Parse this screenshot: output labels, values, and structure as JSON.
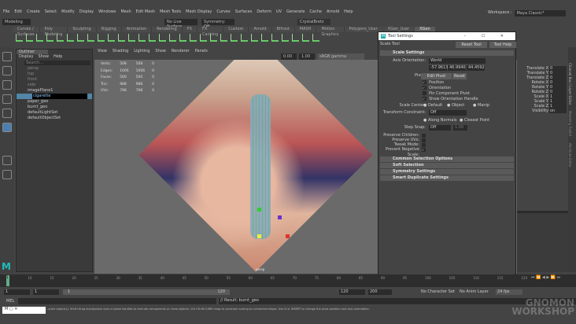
{
  "menu": [
    "File",
    "Edit",
    "Create",
    "Select",
    "Modify",
    "Display",
    "Windows",
    "Mesh",
    "Edit Mesh",
    "Mesh Tools",
    "Mesh Display",
    "Curves",
    "Surfaces",
    "Deform",
    "UV",
    "Generate",
    "Cache",
    "Arnold",
    "Help"
  ],
  "workspace": {
    "label": "Workspace :",
    "value": "Maya Classic*"
  },
  "status": {
    "mode": "Modeling",
    "live": "No Live Surface",
    "symmetry": "Symmetry: Off",
    "user": "CrystalBretz"
  },
  "shelf_tabs": [
    "Curves / Surfaces",
    "Poly Modeling",
    "Sculpting",
    "Rigging",
    "Animation",
    "Rendering",
    "FX",
    "FX Caching",
    "Custom",
    "Arnold",
    "Bifrost",
    "MASH",
    "Motion Graphics",
    "Polygons_User",
    "XGen_User",
    "XGen"
  ],
  "outliner": {
    "title": "Outliner",
    "menu": [
      "Display",
      "Show",
      "Help"
    ],
    "search": "Search...",
    "items": [
      "persp",
      "top",
      "front",
      "side",
      "imagePlane1",
      "cigarette",
      "paper_geo",
      "burnt_geo",
      "defaultLightSet",
      "defaultObjectSet"
    ]
  },
  "viewport": {
    "menu": [
      "View",
      "Shading",
      "Lighting",
      "Show",
      "Renderer",
      "Panels"
    ],
    "exposure": "0.00",
    "gamma": "1.00",
    "colorspace": "sRGB gamma",
    "camera": "persp",
    "hud": [
      [
        "Verts:",
        "508",
        "508",
        "0"
      ],
      [
        "Edges:",
        "1006",
        "1006",
        "0"
      ],
      [
        "Faces:",
        "500",
        "500",
        "0"
      ],
      [
        "Tris:",
        "988",
        "988",
        "0"
      ],
      [
        "UVs:",
        "798",
        "798",
        "0"
      ]
    ]
  },
  "tool_settings": {
    "title": "Tool Settings",
    "tool": "Scale Tool",
    "reset": "Reset Tool",
    "help": "Tool Help",
    "section": "Scale Settings",
    "axis_label": "Axis Orientation:",
    "axis_value": "World",
    "vec": [
      "-57.9613",
      "46.9940",
      "44.4592"
    ],
    "pivot_label": "Pivot:",
    "edit_pivot": "Edit Pivot",
    "pivot_reset": "Reset",
    "checks": [
      [
        "Position",
        true
      ],
      [
        "Orientation",
        true
      ],
      [
        "Pin Component Pivot",
        false
      ],
      [
        "Show Orientation Handle",
        true
      ]
    ],
    "scale_center_label": "Scale Center:",
    "scale_center": [
      "Default",
      "Object",
      "Manip"
    ],
    "constraint_label": "Transform Constraint:",
    "constraint_value": "Off",
    "normals": [
      "Along Normals",
      "Closest Point"
    ],
    "snap_label": "Step Snap:",
    "snap_value": "Off",
    "snap_num": "1.00",
    "opts": [
      [
        "Preserve Children:",
        false
      ],
      [
        "Preserve UVs:",
        false
      ],
      [
        "Tweak Mode:",
        false
      ],
      [
        "Prevent Negative Scale:",
        true
      ]
    ],
    "frames": [
      "Common Selection Options",
      "Soft Selection",
      "Symmetry Settings",
      "Smart Duplicate Settings"
    ]
  },
  "channels": [
    [
      "Translate X",
      "0"
    ],
    [
      "Translate Y",
      "0"
    ],
    [
      "Translate Z",
      "0"
    ],
    [
      "Rotate X",
      "0"
    ],
    [
      "Rotate Y",
      "0"
    ],
    [
      "Rotate Z",
      "0"
    ],
    [
      "Scale X",
      "1"
    ],
    [
      "Scale Y",
      "1"
    ],
    [
      "Scale Z",
      "1"
    ],
    [
      "Visibility",
      "on"
    ]
  ],
  "right_tabs": [
    "Channel Box / Layer Editor",
    "Modeling Toolkit",
    "Attribute Editor"
  ],
  "timeline": {
    "ticks": [
      "5",
      "10",
      "15",
      "20",
      "25",
      "30",
      "35",
      "40",
      "45",
      "50",
      "55",
      "60",
      "65",
      "70",
      "75",
      "80",
      "85",
      "90",
      "95",
      "100",
      "105",
      "110",
      "115",
      "120"
    ],
    "current": "1",
    "start": "1",
    "start2": "1",
    "range_start": "1",
    "range_end": "120",
    "end": "120",
    "end2": "200",
    "char_set": "No Character Set",
    "anim_layer": "No Anim Layer",
    "fps": "24 fps"
  },
  "cmd": {
    "label": "MEL",
    "result": "// Result: burnt_geo"
  },
  "help": "...scale object(s). Shift+drag manipulator axis or plane handles to extrude components or clone objects. Ctrl+Shift+LMB+drag to constrain scaling to connected edges. Use D or INSERT to change the pivot position and axis orientation.",
  "watermark": "The Gnomon Workshop"
}
